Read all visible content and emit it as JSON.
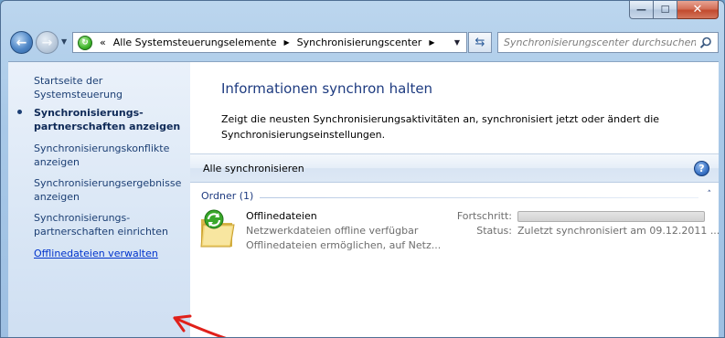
{
  "window": {
    "caption_buttons": {
      "minimize": "—",
      "maximize": "☐",
      "close": "✕"
    }
  },
  "navigation": {
    "breadcrumb": [
      {
        "label": "«"
      },
      {
        "label": "Alle Systemsteuerungselemente"
      },
      {
        "label": "Synchronisierungscenter"
      }
    ],
    "search_placeholder": "Synchronisierungscenter durchsuchen"
  },
  "sidebar": {
    "items": [
      {
        "label": "Startseite der Systemsteuerung"
      },
      {
        "label": "Synchronisierungs-partnerschaften anzeigen",
        "current": true
      },
      {
        "label": "Synchronisierungskonflikte anzeigen"
      },
      {
        "label": "Synchronisierungsergebnisse anzeigen"
      },
      {
        "label": "Synchronisierungs-partnerschaften einrichten"
      },
      {
        "label": "Offlinedateien verwalten"
      }
    ]
  },
  "main": {
    "title": "Informationen synchron halten",
    "description": "Zeigt die neusten Synchronisierungsaktivitäten an, synchronisiert jetzt oder ändert die Synchronisierungseinstellungen.",
    "toolbar": {
      "sync_all": "Alle synchronisieren",
      "help": "?"
    },
    "group": {
      "label": "Ordner (1)",
      "collapse": "˄"
    },
    "items": [
      {
        "name": "Offlinedateien",
        "line1": "Netzwerkdateien offline verfügbar",
        "line2": "Offlinedateien ermöglichen, auf Netz...",
        "progress_label": "Fortschritt:",
        "progress": 0,
        "status_label": "Status:",
        "status": "Zuletzt synchronisiert am 09.12.2011 ..."
      }
    ]
  },
  "colors": {
    "accent": "#1e3b80",
    "link": "#0033cc",
    "annotation": "#e0201a"
  }
}
